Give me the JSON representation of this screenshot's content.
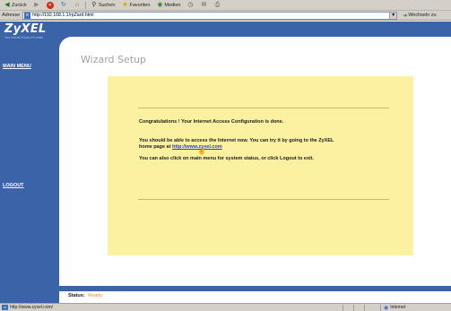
{
  "browser": {
    "toolbar": {
      "back_label": "Zurück",
      "search_label": "Suchen",
      "favorites_label": "Favoriten",
      "media_label": "Medien"
    },
    "address": {
      "label": "Adresse",
      "url": "http://192.168.1.1/rpZard.html",
      "go_label": "Wechseln zu"
    },
    "statusbar": {
      "url": "http://www.zyxel.com/",
      "zone": "Internet"
    }
  },
  "page": {
    "brand": "ZyXEL",
    "brand_tagline": "Your Internet Solution Provider",
    "menu": {
      "main_menu": "MAIN MENU",
      "logout": "LOGOUT"
    },
    "title": "Wizard Setup",
    "message": {
      "line1": "Congratulations ! Your Internet Access Configuration is done.",
      "line2": "You should be able to access the Internet now. You can try it by going to the ZyXEL",
      "line3_prefix": "home page at",
      "link": "http://www.zyxel.com",
      "line4": "You can also click on main menu for system status, or click Logout to exit."
    },
    "status": {
      "label": "Status:",
      "value": "Ready"
    }
  },
  "colors": {
    "brand_blue": "#3b63a8",
    "message_panel": "#fbf1a0",
    "status_orange": "#f08a2a"
  }
}
